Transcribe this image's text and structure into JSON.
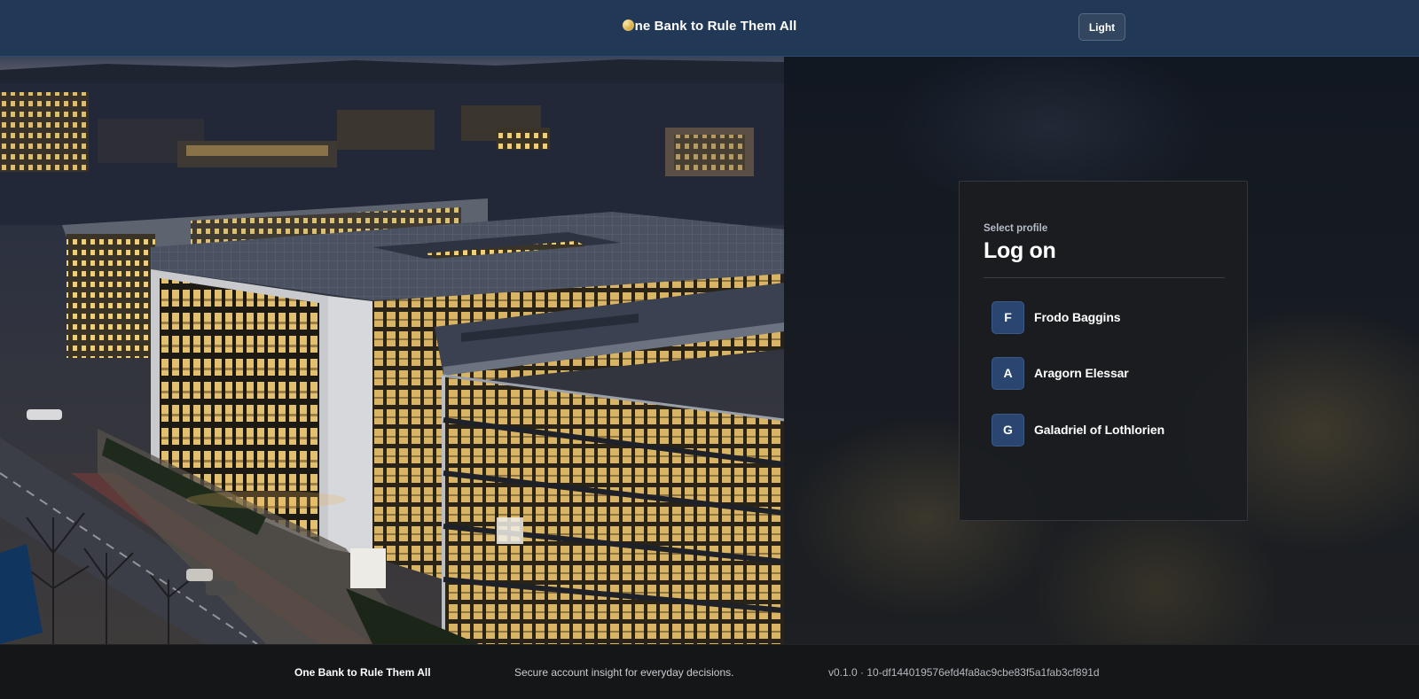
{
  "header": {
    "app_title": "ne Bank to Rule Them All",
    "theme_toggle_label": "Light"
  },
  "hero": {
    "image_subject": "illuminated office campus at dusk"
  },
  "login": {
    "eyebrow": "Select profile",
    "title": "Log on",
    "profiles": [
      {
        "initial": "F",
        "name": "Frodo Baggins"
      },
      {
        "initial": "A",
        "name": "Aragorn Elessar"
      },
      {
        "initial": "G",
        "name": "Galadriel of Lothlorien"
      }
    ]
  },
  "footer": {
    "brand": "One Bank to Rule Them All",
    "tagline": "Secure account insight for everyday decisions.",
    "version": "v0.1.0 · 10-df144019576efd4fa8ac9cbe83f5a1fab3cf891d"
  },
  "colors": {
    "header_bg": "#213857",
    "card_bg": "#1b1d20",
    "avatar_bg": "#2a4670",
    "footer_bg": "#151617"
  },
  "icons": {
    "logo": "gold-ring-icon"
  }
}
